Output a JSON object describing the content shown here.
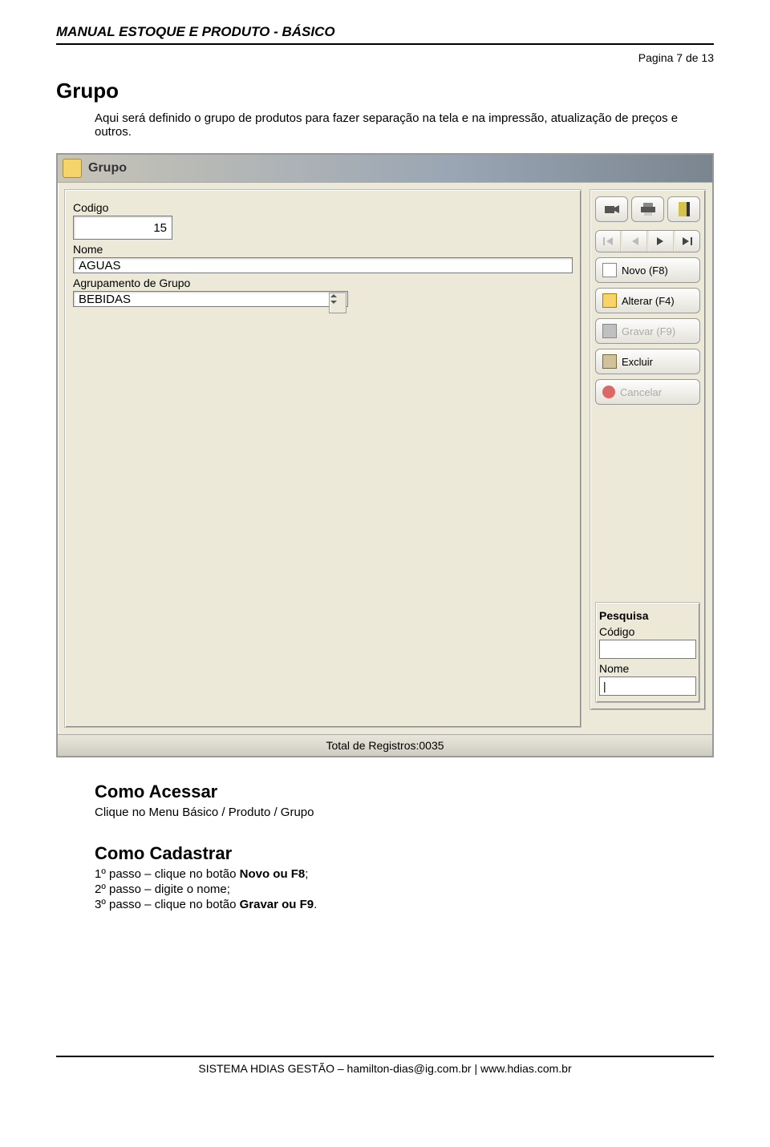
{
  "doc": {
    "header_title": "MANUAL ESTOQUE E PRODUTO - BÁSICO",
    "page_indicator": "Pagina 7 de 13",
    "section_title": "Grupo",
    "intro": "Aqui será definido o grupo de produtos para fazer separação na tela e na impressão, atualização de preços e outros.",
    "como_acessar_title": "Como Acessar",
    "como_acessar_text": "Clique no Menu Básico / Produto / Grupo",
    "como_cadastrar_title": "Como Cadastrar",
    "step1_prefix": "1º passo – clique no botão ",
    "step1_bold": "Novo ou F8",
    "step1_suffix": ";",
    "step2": "2º passo – digite o nome;",
    "step3_prefix": "3º passo – clique no botão ",
    "step3_bold": "Gravar ou F9",
    "step3_suffix": ".",
    "footer": "SISTEMA HDIAS GESTÃO – hamilton-dias@ig.com.br | www.hdias.com.br"
  },
  "window": {
    "title": "Grupo",
    "labels": {
      "codigo": "Codigo",
      "nome": "Nome",
      "agrupamento": "Agrupamento de Grupo"
    },
    "values": {
      "codigo": "15",
      "nome": "AGUAS",
      "agrupamento": "BEBIDAS"
    },
    "buttons": {
      "novo": "Novo (F8)",
      "alterar": "Alterar (F4)",
      "gravar": "Gravar (F9)",
      "excluir": "Excluir",
      "cancelar": "Cancelar"
    },
    "pesquisa": {
      "title": "Pesquisa",
      "codigo_label": "Código",
      "nome_label": "Nome",
      "codigo_value": "",
      "nome_value": "|"
    },
    "status": "Total de Registros:0035"
  }
}
